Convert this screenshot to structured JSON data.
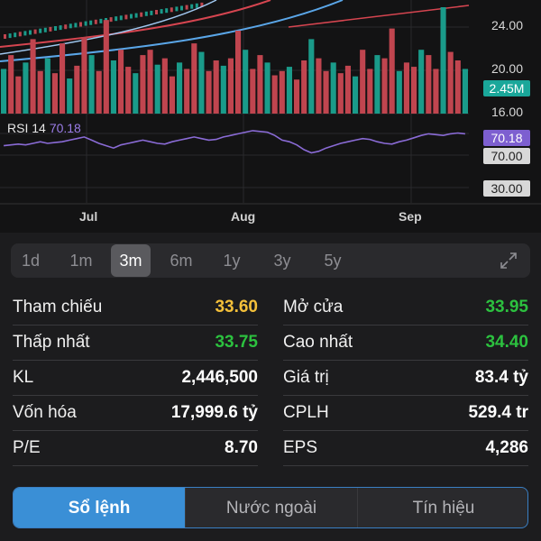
{
  "chart": {
    "price_axis": [
      "24.00",
      "20.00",
      "16.00"
    ],
    "volume_tag": "2.45M",
    "rsi_label": "RSI 14",
    "rsi_value": "70.18",
    "rsi_tags": [
      "70.18",
      "70.00",
      "30.00"
    ],
    "months": [
      "Jul",
      "Aug",
      "Sep"
    ],
    "colors": {
      "up": "#1a9b8a",
      "down": "#c0454f",
      "rsi": "#8a6bd6",
      "volume_tag": "#1aa79a"
    }
  },
  "chart_data": {
    "type": "bar",
    "series": [
      {
        "name": "volume",
        "values": [
          0.42,
          0.55,
          0.35,
          0.48,
          0.7,
          0.4,
          0.52,
          0.38,
          0.66,
          0.33,
          0.45,
          0.72,
          0.55,
          0.4,
          0.88,
          0.5,
          0.6,
          0.44,
          0.38,
          0.55,
          0.6,
          0.46,
          0.52,
          0.35,
          0.48,
          0.42,
          0.66,
          0.58,
          0.4,
          0.5,
          0.45,
          0.52,
          0.78,
          0.6,
          0.42,
          0.55,
          0.48,
          0.36,
          0.4,
          0.44,
          0.32,
          0.5,
          0.7,
          0.52,
          0.4,
          0.48,
          0.38,
          0.45,
          0.35,
          0.6,
          0.42,
          0.55,
          0.52,
          0.8,
          0.4,
          0.48,
          0.44,
          0.6,
          0.55,
          0.42,
          1.0,
          0.58,
          0.5,
          0.42
        ]
      },
      {
        "name": "rsi",
        "values": [
          55,
          56,
          57,
          56,
          58,
          60,
          58,
          59,
          60,
          62,
          64,
          66,
          62,
          58,
          55,
          52,
          56,
          58,
          60,
          62,
          60,
          58,
          57,
          60,
          62,
          64,
          66,
          64,
          62,
          63,
          66,
          68,
          70,
          72,
          74,
          73,
          72,
          68,
          62,
          60,
          56,
          50,
          46,
          48,
          52,
          55,
          58,
          60,
          62,
          64,
          63,
          60,
          58,
          57,
          60,
          62,
          65,
          68,
          70,
          69,
          68,
          70,
          71,
          70
        ]
      }
    ],
    "rsi_levels": [
      70,
      30
    ]
  },
  "range": {
    "options": [
      "1d",
      "1m",
      "3m",
      "6m",
      "1y",
      "3y",
      "5y"
    ],
    "active": "3m"
  },
  "stats": [
    {
      "left_label": "Tham chiếu",
      "left_value": "33.60",
      "left_color": "yellow",
      "right_label": "Mở cửa",
      "right_value": "33.95",
      "right_color": "green"
    },
    {
      "left_label": "Thấp nhất",
      "left_value": "33.75",
      "left_color": "green",
      "right_label": "Cao nhất",
      "right_value": "34.40",
      "right_color": "green"
    },
    {
      "left_label": "KL",
      "left_value": "2,446,500",
      "left_color": "",
      "right_label": "Giá trị",
      "right_value": "83.4 tỷ",
      "right_color": ""
    },
    {
      "left_label": "Vốn hóa",
      "left_value": "17,999.6 tỷ",
      "left_color": "",
      "right_label": "CPLH",
      "right_value": "529.4 tr",
      "right_color": ""
    },
    {
      "left_label": "P/E",
      "left_value": "8.70",
      "left_color": "",
      "right_label": "EPS",
      "right_value": "4,286",
      "right_color": ""
    }
  ],
  "tabs": [
    "Sổ lệnh",
    "Nước ngoài",
    "Tín hiệu"
  ],
  "active_tab": "Sổ lệnh"
}
